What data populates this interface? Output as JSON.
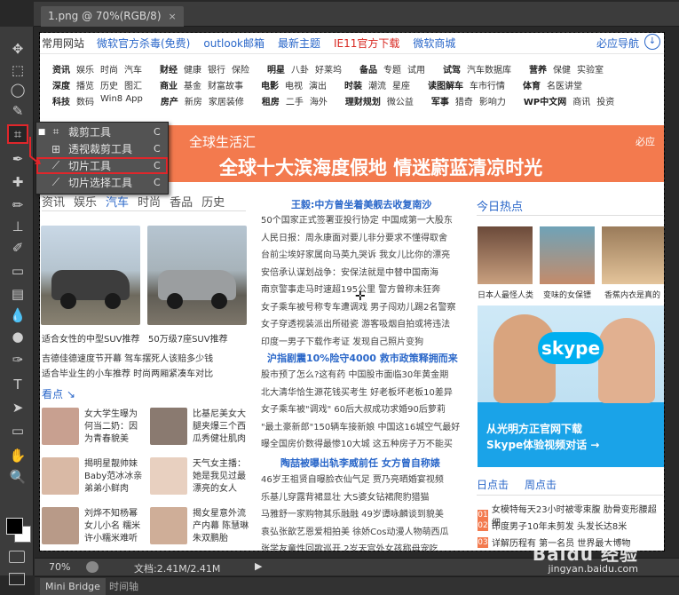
{
  "document": {
    "tab_title": "1.png @ 70%(RGB/8)",
    "close_glyph": "×"
  },
  "tools": [
    {
      "name": "move-icon",
      "glyph": "✥"
    },
    {
      "name": "marquee-icon",
      "glyph": "⬚"
    },
    {
      "name": "lasso-icon",
      "glyph": "◯"
    },
    {
      "name": "quick-select-icon",
      "glyph": "✎"
    },
    {
      "name": "crop-icon",
      "glyph": "⌗"
    },
    {
      "name": "eyedropper-icon",
      "glyph": "✒"
    },
    {
      "name": "healing-icon",
      "glyph": "✚"
    },
    {
      "name": "brush-icon",
      "glyph": "✏"
    },
    {
      "name": "stamp-icon",
      "glyph": "⊥"
    },
    {
      "name": "history-brush-icon",
      "glyph": "✐"
    },
    {
      "name": "eraser-icon",
      "glyph": "▭"
    },
    {
      "name": "gradient-icon",
      "glyph": "▤"
    },
    {
      "name": "blur-icon",
      "glyph": "💧"
    },
    {
      "name": "dodge-icon",
      "glyph": "●"
    },
    {
      "name": "pen-icon",
      "glyph": "✑"
    },
    {
      "name": "type-icon",
      "glyph": "T"
    },
    {
      "name": "path-select-icon",
      "glyph": "➤"
    },
    {
      "name": "shape-icon",
      "glyph": "▭"
    },
    {
      "name": "hand-icon",
      "glyph": "✋"
    },
    {
      "name": "zoom-icon",
      "glyph": "🔍"
    }
  ],
  "flyout": [
    {
      "label": "裁剪工具",
      "key": "C",
      "icon": "⌗",
      "bullet": "■"
    },
    {
      "label": "透视裁剪工具",
      "key": "C",
      "icon": "⊞",
      "bullet": ""
    },
    {
      "label": "切片工具",
      "key": "C",
      "icon": "⟋",
      "bullet": ""
    },
    {
      "label": "切片选择工具",
      "key": "C",
      "icon": "⟋",
      "bullet": ""
    }
  ],
  "webpage": {
    "home": "常用网站",
    "top_links": [
      "微软官方杀毒(免费)",
      "outlook邮箱",
      "最新主题",
      "IE11官方下载",
      "微软商城"
    ],
    "nav_right": "必应导航",
    "link_rows": [
      [
        [
          "资讯",
          "娱乐",
          "时尚",
          "汽车"
        ],
        [
          "财经",
          "健康",
          "银行",
          "保险"
        ],
        [
          "明星",
          "八卦",
          "好莱坞"
        ],
        [
          "备品",
          "专题",
          "试用"
        ],
        [
          "试驾",
          "汽车数据库"
        ],
        [
          "营养",
          "保健",
          "实验室"
        ]
      ],
      [
        [
          "深度",
          "播览",
          "历史",
          "图汇"
        ],
        [
          "商业",
          "基金",
          "财富故事"
        ],
        [
          "电影",
          "电视",
          "演出"
        ],
        [
          "时装",
          "潮流",
          "星座"
        ],
        [
          "读图解车",
          "车市行情"
        ],
        [
          "体育",
          "名医讲堂"
        ]
      ],
      [
        [
          "科技",
          "数码",
          "Win8 App"
        ],
        [
          "房产",
          "新房",
          "家居装修"
        ],
        [
          "租房",
          "二手",
          "海外"
        ],
        [
          "理财规划",
          "微公益"
        ],
        [
          "军事",
          "猎奇",
          "影响力"
        ],
        [
          "WP中文网",
          "商讯",
          "投资"
        ]
      ]
    ],
    "banner_small": "全球生活汇",
    "banner_big": "全球十大滨海度假地 情迷蔚蓝清凉时光",
    "banner_brand": "必应",
    "tabs": [
      "资讯",
      "娱乐",
      "汽车",
      "时尚",
      "香品",
      "历史"
    ],
    "car_caps": [
      "适合女性的中型SUV推荐",
      "50万级7座SUV推荐"
    ],
    "left_news": [
      "吉德佳德速度节开幕 驾车摆死人该赔多少钱",
      "适合毕业生的小车推荐 时尚两厢紧凑车对比"
    ],
    "look_title": "看点 ↘",
    "look_items": [
      "女大学生曝为何当二奶：因为青春貌美",
      "比基尼美女大腿夹爆三个西瓜秀健壮肌肉",
      "揭明星靓帅妹Baby范冰冰亲弟弟小鲜肉",
      "天气女主播：她是我见过最漂亮的女人",
      "刘烨不知杨幂女儿小名 糯米 许小糯米难听",
      "揭女星意外流产内幕 陈慧琳朱双鹏胎"
    ],
    "mid_h1": "王毅:中方曾坐着美舰去收复南沙",
    "mid_p1": [
      "50个国家正式签署亚投行协定 中国成第一大股东",
      "人民日报：周永康面对要儿非分要求不懂得取舍",
      "台前尘埃好家属向马英九哭诉 我女儿比你的漂亮",
      "安倍承认谋划战争：安保法就是中替中国南海",
      "南京警事走马时速超195公里 警方曾称未狂奔",
      "女子乘车被号称专车遭调戏 男子闯劝儿踢2名警察",
      "女子穿透视装派出所碰瓷 游客吸烟自拍或将违法",
      "印度一男子下载作考证 发现自己照片变狗"
    ],
    "mid_h2": "沪指剧震10%险守4000 救市政策释拥而来",
    "mid_p2": [
      "股市预了怎么?这有药 中国股市面临30年黄金期",
      "北大清华恰生源花钱买考生 好老板坏老板10差异",
      "女子乘车被\"调戏\" 60后大叔成功求婚90后萝莉",
      "\"最土豪新郎\"150辆车接新娘 中国这16城空气最好",
      "曝全国房价数得最惨10大城 这五种房子万不能买"
    ],
    "mid_h3": "陶喆被曝出轨李威前任 女方曾自称婊",
    "mid_p3": [
      "46岁王祖贤自曝脸衣仙气足 贾乃亮晒婚宴视频",
      "乐基儿穿露背裙显壮 大S婆女钻裙爬豹猎猫",
      "马雅舒一家购物其乐融融 49岁谭咏麟谈到貌美",
      "袁弘张歆艺恩爱相拍美 徐娇Cos动漫人物萌西瓜",
      "张学友童性回歌巡开 2岁天宫外女孩称母宠吃"
    ],
    "today_title": "今日热点",
    "today_caps": [
      "日本人最怪人类",
      "变味的女保镖",
      "香蕉内衣是真的"
    ],
    "skype_logo": "skype",
    "skype_l1": "从光明方正官网下载",
    "skype_l2": "Skype体验视频对话 →",
    "rtabs": [
      "日点击",
      "周点击"
    ],
    "ranks": [
      {
        "n": "01",
        "t": "女模特每天23小时被零束腹 肋骨变形腰超细"
      },
      {
        "n": "02",
        "t": "印度男子10年未剪发 头发长达8米"
      },
      {
        "n": "03",
        "t": "详解历程有 第一名员 世界最大博物"
      }
    ]
  },
  "status": {
    "zoom": "70%",
    "doc": "文档:2.41M/2.41M",
    "play": "▶"
  },
  "panels": {
    "tab1": "Mini Bridge",
    "tab2": "时间轴"
  },
  "watermark": {
    "main": "Baidu 经验",
    "sub": "jingyan.baidu.com"
  },
  "colors": {
    "accent_red": "#e0262b",
    "link_blue": "#2a67c9",
    "banner_orange": "#f37a4e",
    "ui_gray": "#3c3c3c"
  }
}
